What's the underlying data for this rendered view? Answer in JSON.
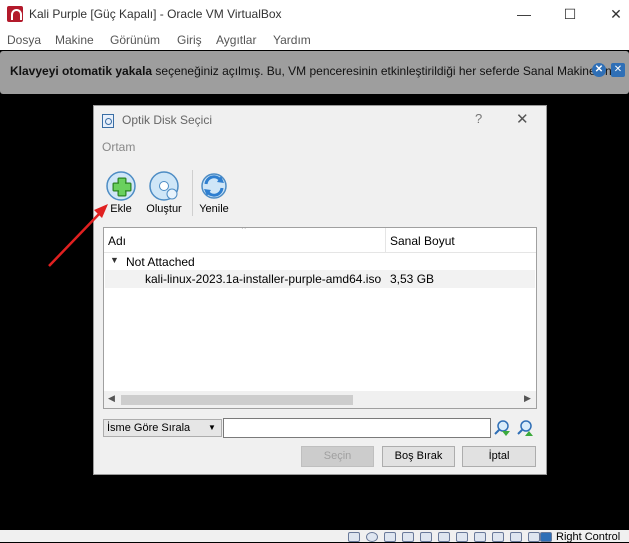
{
  "window": {
    "title": "Kali Purple [Güç Kapalı] - Oracle VM VirtualBox",
    "controls": [
      "—",
      "☐",
      "✕"
    ]
  },
  "menu": [
    "Dosya",
    "Makine",
    "Görünüm",
    "Giriş",
    "Aygıtlar",
    "Yardım"
  ],
  "notification": {
    "bold": "Klavyeyi otomatik yakala",
    "text": " seçeneğiniz açılmış. Bu, VM penceresinin etkinleştirildiği her seferde Sanal Makinenin"
  },
  "dialog": {
    "title": "Optik Disk Seçici",
    "help": "?",
    "close": "✕",
    "section": "Ortam",
    "toolbar": {
      "add": "Ekle",
      "create": "Oluştur",
      "refresh": "Yenile"
    },
    "columns": {
      "name": "Adı",
      "size": "Sanal Boyut"
    },
    "group": "Not Attached",
    "rows": [
      {
        "name": "kali-linux-2023.1a-installer-purple-amd64.iso",
        "size": "3,53 GB"
      }
    ],
    "sort_select": "İsme Göre Sırala",
    "search_value": "",
    "buttons": {
      "choose": "Seçin",
      "leave_empty": "Boş Bırak",
      "cancel": "İptal"
    }
  },
  "statusbar": {
    "host_key": "Right Control"
  },
  "colors": {
    "annotation_arrow": "#e02020",
    "notify_bg": "#9e9e9e",
    "accent": "#2f6fb6"
  }
}
